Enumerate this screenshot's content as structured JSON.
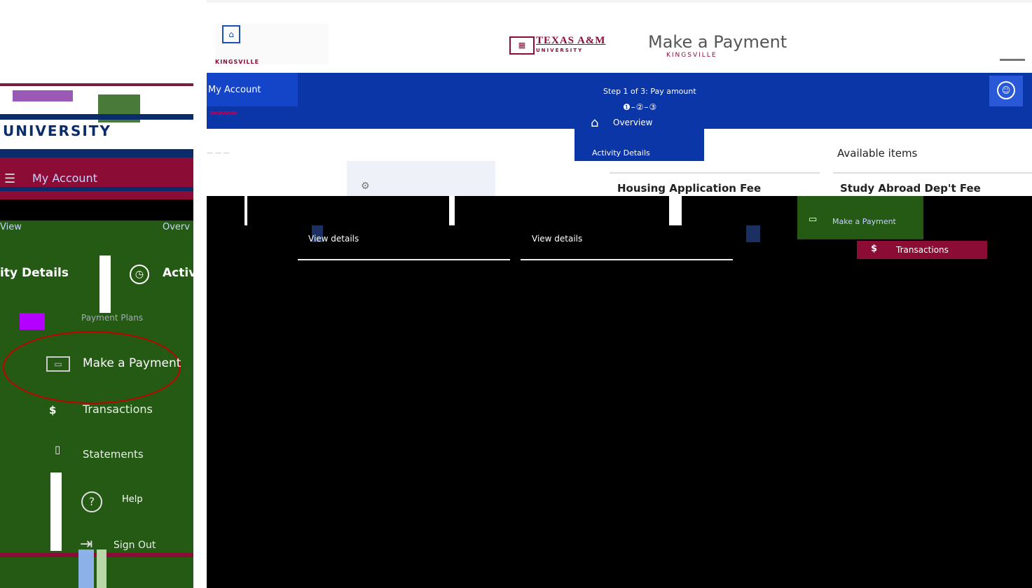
{
  "sidebar": {
    "logo_text": "UNIVERSITY",
    "account_label": "My Account",
    "overview_label": "View",
    "overview_label2": "Overv",
    "activity_label": "ity Details",
    "activity_label2": "Activ",
    "payment_plans_label": "Payment Plans",
    "make_payment_label": "Make a Payment",
    "transactions_label": "Transactions",
    "statements_label": "Statements",
    "help_label": "Help",
    "signout_label": "Sign Out",
    "highlight_color": "#c40000"
  },
  "header": {
    "title": "Make a Payment",
    "logo_text": "TEXAS A&M",
    "logo_sub": "UNIVERSITY",
    "kv_text": "KINGSVILLE",
    "ghost_sub": "KINGSVILLE"
  },
  "topbar": {
    "my_account": "My Account",
    "step_text": "Step 1 of 3: Pay amount",
    "steps": "❶–②–③",
    "brand_color": "#0b36a8"
  },
  "nav": {
    "overview": "Overview",
    "activity": "Activity Details"
  },
  "main": {
    "available_items": "Available items",
    "card1_title": "Housing Application Fee",
    "card2_title": "Study Abroad Dep't Fee",
    "view_details_1": "View details",
    "view_details_2": "View details",
    "make_payment": "Make a Payment",
    "transactions": "Transactions"
  }
}
